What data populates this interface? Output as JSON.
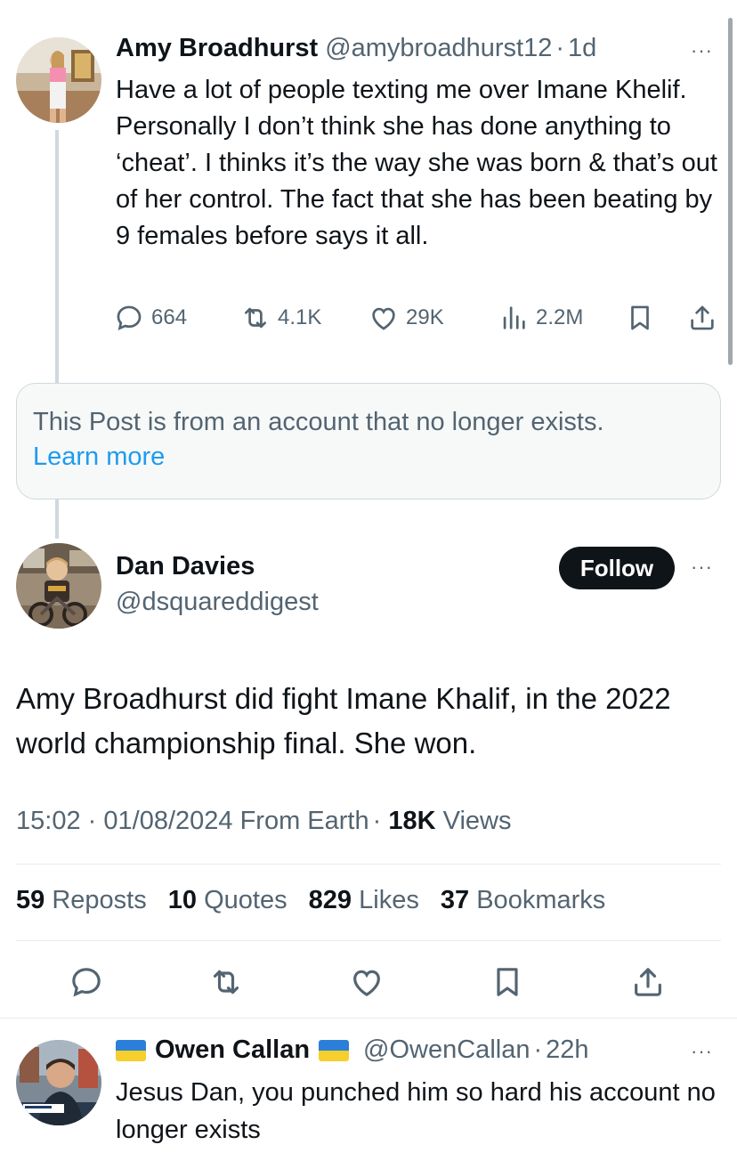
{
  "tweet1": {
    "name": "Amy Broadhurst",
    "handle": "@amybroadhurst12",
    "time": "1d",
    "text": "Have a lot of people texting me over Imane Khelif. Personally I don’t think she has done anything to ‘cheat’. I thinks it’s the way she was born & that’s out of her control. The fact that she has been beating by 9 females before says it all.",
    "replies": "664",
    "reposts": "4.1K",
    "likes": "29K",
    "views": "2.2M"
  },
  "notice": {
    "text": "This Post is from an account that no longer exists.",
    "link": "Learn more"
  },
  "tweet2": {
    "name": "Dan Davies",
    "handle": "@dsquareddigest",
    "follow_label": "Follow",
    "text": "Amy Broadhurst  did fight Imane Khalif, in the 2022 world championship final. She won.",
    "time": "15:02",
    "date": "01/08/2024",
    "source": "From Earth",
    "views_count": "18K",
    "views_label": "Views",
    "reposts_count": "59",
    "reposts_label": "Reposts",
    "quotes_count": "10",
    "quotes_label": "Quotes",
    "likes_count": "829",
    "likes_label": "Likes",
    "bookmarks_count": "37",
    "bookmarks_label": "Bookmarks"
  },
  "tweet3": {
    "name": "Owen Callan",
    "handle": "@OwenCallan",
    "time": "22h",
    "text": "Jesus Dan, you punched him so hard his account no longer exists"
  },
  "separator_dot": "·",
  "more_glyph": "···",
  "colors": {
    "link": "#1d9bf0",
    "muted": "#536471",
    "text": "#0f1419",
    "follow_bg": "#0f1419"
  }
}
